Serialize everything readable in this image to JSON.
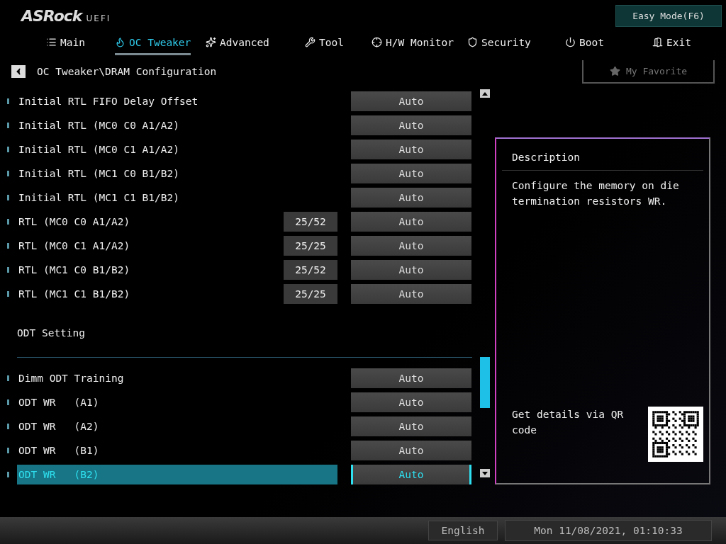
{
  "logo": {
    "brand": "ASRock",
    "suffix": "UEFI"
  },
  "easy_mode_button": "Easy Mode(F6)",
  "tabs": [
    {
      "label": "Main",
      "selected": false
    },
    {
      "label": "OC Tweaker",
      "selected": true
    },
    {
      "label": "Advanced",
      "selected": false
    },
    {
      "label": "Tool",
      "selected": false
    },
    {
      "label": "H/W Monitor",
      "selected": false
    },
    {
      "label": "Security",
      "selected": false
    },
    {
      "label": "Boot",
      "selected": false
    },
    {
      "label": "Exit",
      "selected": false
    }
  ],
  "breadcrumb": "OC Tweaker\\DRAM Configuration",
  "favorite_button": "My Favorite",
  "settings": [
    {
      "kind": "setting",
      "label": "Initial RTL FIFO Delay Offset",
      "value": "Auto",
      "selected": false
    },
    {
      "kind": "setting",
      "label": "Initial RTL (MC0 C0 A1/A2)",
      "value": "Auto",
      "selected": false
    },
    {
      "kind": "setting",
      "label": "Initial RTL (MC0 C1 A1/A2)",
      "value": "Auto",
      "selected": false
    },
    {
      "kind": "setting",
      "label": "Initial RTL (MC1 C0 B1/B2)",
      "value": "Auto",
      "selected": false
    },
    {
      "kind": "setting",
      "label": "Initial RTL (MC1 C1 B1/B2)",
      "value": "Auto",
      "selected": false
    },
    {
      "kind": "setting",
      "label": "RTL (MC0 C0 A1/A2)",
      "reading": "25/52",
      "value": "Auto",
      "selected": false
    },
    {
      "kind": "setting",
      "label": "RTL (MC0 C1 A1/A2)",
      "reading": "25/25",
      "value": "Auto",
      "selected": false
    },
    {
      "kind": "setting",
      "label": "RTL (MC1 C0 B1/B2)",
      "reading": "25/52",
      "value": "Auto",
      "selected": false
    },
    {
      "kind": "setting",
      "label": "RTL (MC1 C1 B1/B2)",
      "reading": "25/25",
      "value": "Auto",
      "selected": false
    },
    {
      "kind": "section",
      "label": "ODT Setting"
    },
    {
      "kind": "setting",
      "label": "Dimm ODT Training",
      "value": "Auto",
      "selected": false
    },
    {
      "kind": "setting",
      "label": "ODT WR   (A1)",
      "value": "Auto",
      "selected": false
    },
    {
      "kind": "setting",
      "label": "ODT WR   (A2)",
      "value": "Auto",
      "selected": false
    },
    {
      "kind": "setting",
      "label": "ODT WR   (B1)",
      "value": "Auto",
      "selected": false
    },
    {
      "kind": "setting",
      "label": "ODT WR   (B2)",
      "value": "Auto",
      "selected": true
    }
  ],
  "description": {
    "title": "Description",
    "text": "Configure the memory on die termination resistors WR.",
    "qr_caption": "Get details via QR code"
  },
  "status_bar": {
    "language": "English",
    "datetime": "Mon 11/08/2021, 01:10:33"
  }
}
